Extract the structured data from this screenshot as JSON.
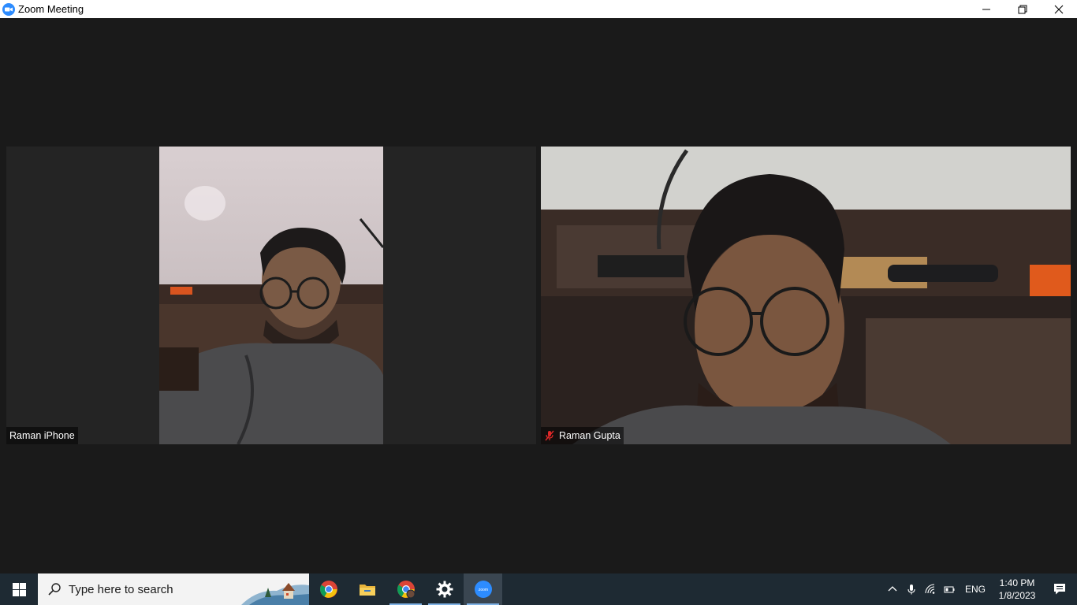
{
  "window": {
    "title": "Zoom Meeting",
    "minimize_icon": "minimize-icon",
    "restore_icon": "restore-icon",
    "close_icon": "close-icon"
  },
  "participants": [
    {
      "name": "Raman iPhone",
      "muted": false
    },
    {
      "name": "Raman Gupta",
      "muted": true
    }
  ],
  "taskbar": {
    "search_placeholder": "Type here to search",
    "apps": [
      {
        "icon": "chrome-icon",
        "active": false
      },
      {
        "icon": "file-explorer-icon",
        "active": false
      },
      {
        "icon": "chrome-profile-icon",
        "active": false,
        "running": true
      },
      {
        "icon": "settings-icon",
        "active": false,
        "running": true
      },
      {
        "icon": "zoom-icon",
        "active": true,
        "running": true
      }
    ],
    "tray": {
      "language": "ENG",
      "time": "1:40 PM",
      "date": "1/8/2023"
    }
  },
  "colors": {
    "meeting_bg": "#1a1a1a",
    "tile_bg": "#242424",
    "taskbar_bg": "#1e2a33",
    "zoom_blue": "#2d8cff",
    "mute_red": "#e02828"
  }
}
